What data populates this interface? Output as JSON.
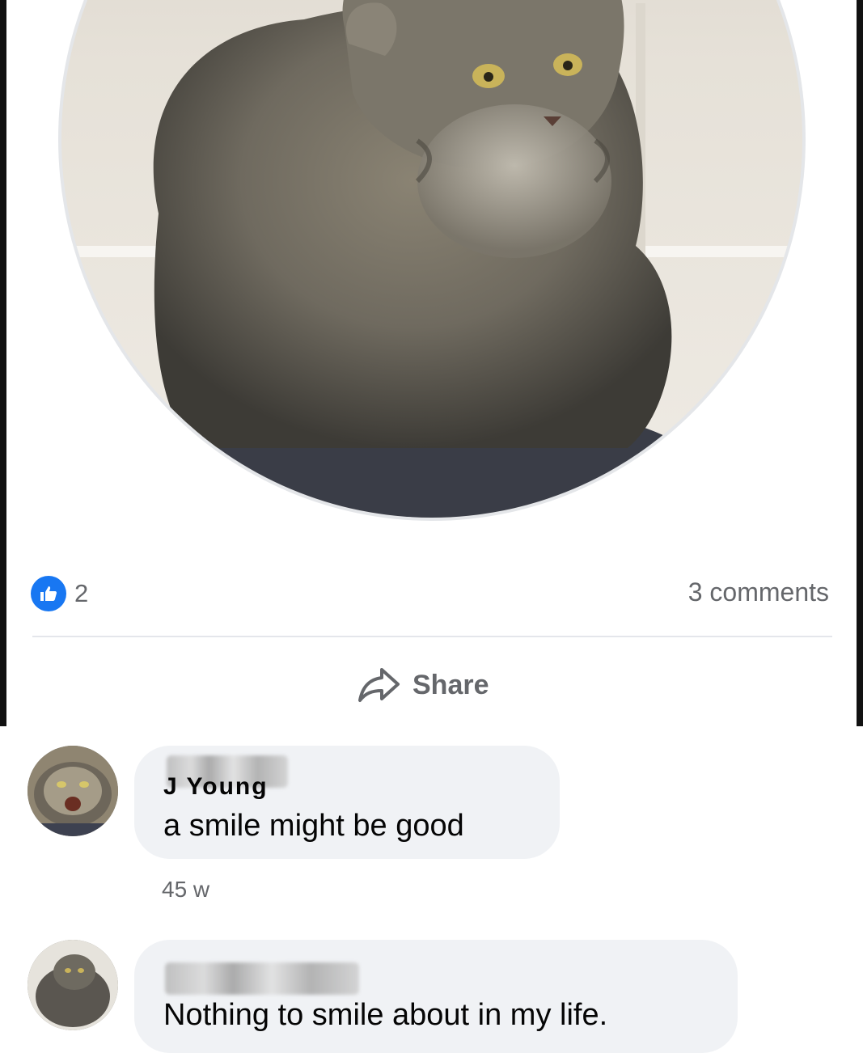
{
  "post": {
    "photo_alt": "profile-photo",
    "reactions": {
      "like_count": "2"
    },
    "comments_count_label": "3 comments",
    "share_label": "Share"
  },
  "comments": [
    {
      "author": "J   Young",
      "text": "a smile might be good",
      "time": "45 w"
    },
    {
      "author": "",
      "text": "Nothing to smile about in my life."
    }
  ],
  "colors": {
    "like_blue": "#1877f2",
    "bubble_bg": "#f0f2f5",
    "secondary_text": "#65676b"
  },
  "icons": [
    "like-icon",
    "share-icon"
  ]
}
